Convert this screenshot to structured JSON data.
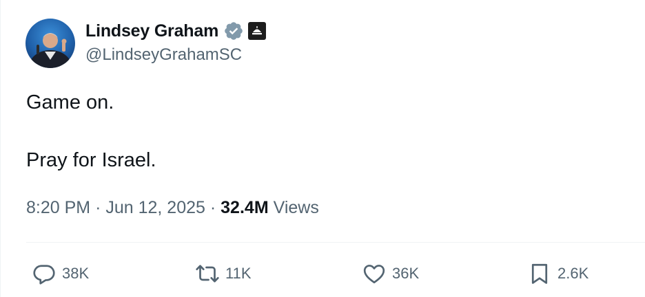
{
  "author": {
    "display_name": "Lindsey Graham",
    "handle": "@LindseyGrahamSC",
    "verified_icon": "verified-badge-icon",
    "affiliation_icon": "government-building-icon"
  },
  "tweet": {
    "lines": [
      "Game on.",
      "Pray for Israel."
    ],
    "time": "8:20 PM",
    "separator": "·",
    "date": "Jun 12, 2025",
    "views_count": "32.4M",
    "views_label": "Views"
  },
  "actions": {
    "reply": "38K",
    "repost": "11K",
    "like": "36K",
    "bookmark": "2.6K"
  },
  "colors": {
    "primary_text": "#0f1419",
    "secondary_text": "#536471",
    "verified_badge": "#829aab",
    "divider": "#eff3f4"
  }
}
